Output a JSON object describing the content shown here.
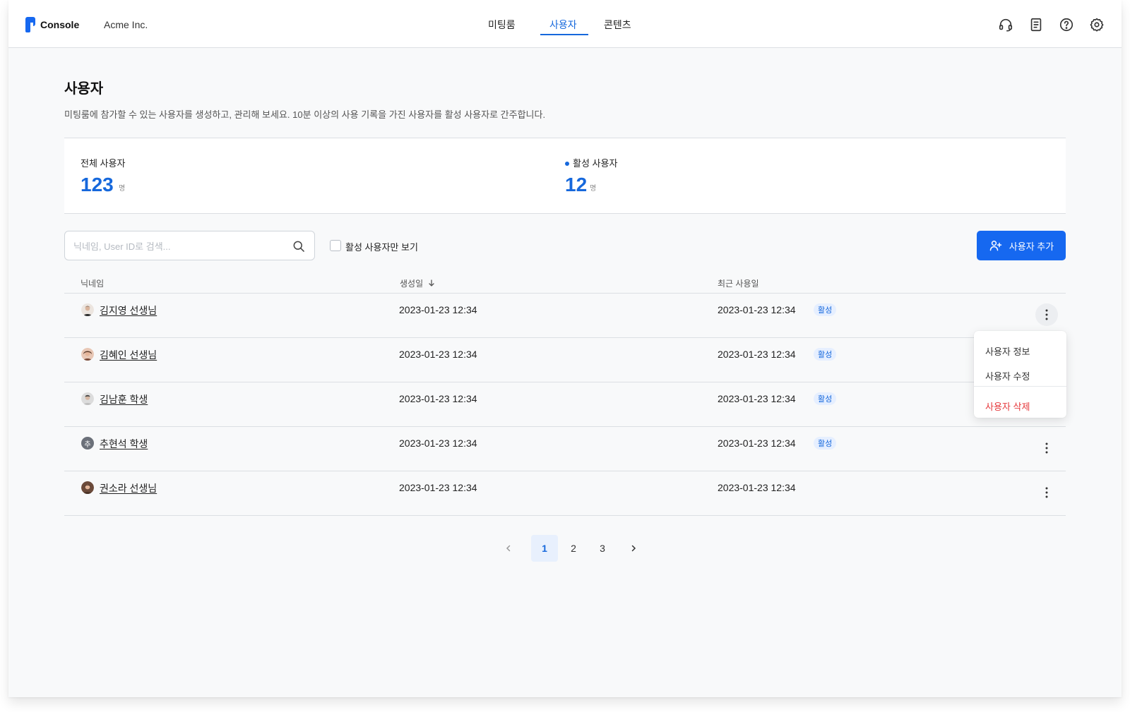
{
  "header": {
    "brand": "Console",
    "org": "Acme Inc.",
    "nav": [
      {
        "label": "미팅룸",
        "active": false
      },
      {
        "label": "사용자",
        "active": true
      },
      {
        "label": "콘텐츠",
        "active": false
      }
    ],
    "icons": [
      "headset-icon",
      "document-icon",
      "help-icon",
      "settings-icon"
    ],
    "accent_color": "#1668dc"
  },
  "page": {
    "title": "사용자",
    "description": "미팅룸에 참가할 수 있는 사용자를 생성하고, 관리해 보세요. 10분 이상의 사용 기록을 가진 사용자를 활성 사용자로 간주합니다."
  },
  "stats": {
    "total": {
      "label": "전체 사용자",
      "value": "123",
      "unit": "명"
    },
    "active": {
      "label": "활성 사용자",
      "value": "12",
      "unit": "명"
    }
  },
  "toolbar": {
    "search_placeholder": "닉네임, User ID로 검색...",
    "search_value": "",
    "filter_label": "활성 사용자만 보기",
    "filter_checked": false,
    "add_button_label": "사용자 추가"
  },
  "table": {
    "columns": [
      "닉네임",
      "생성일",
      "최근 사용일"
    ],
    "sort_column": "생성일",
    "sort_direction": "desc",
    "rows": [
      {
        "name": "김지영 선생님",
        "created": "2023-01-23 12:34",
        "recent": "2023-01-23 12:34",
        "badge": "활성",
        "avatar": "photo"
      },
      {
        "name": "김혜인 선생님",
        "created": "2023-01-23 12:34",
        "recent": "2023-01-23 12:34",
        "badge": "활성",
        "avatar": "photo"
      },
      {
        "name": "김남훈 학생",
        "created": "2023-01-23 12:34",
        "recent": "2023-01-23 12:34",
        "badge": "활성",
        "avatar": "photo"
      },
      {
        "name": "추현석 학생",
        "created": "2023-01-23 12:34",
        "recent": "2023-01-23 12:34",
        "badge": "활성",
        "avatar": "initial",
        "initial": "추"
      },
      {
        "name": "권소라 선생님",
        "created": "2023-01-23 12:34",
        "recent": "2023-01-23 12:34",
        "badge": "",
        "avatar": "photo"
      }
    ]
  },
  "menu": {
    "items": [
      {
        "label": "사용자 정보"
      },
      {
        "label": "사용자 수정"
      },
      {
        "label": "사용자 삭제",
        "danger": true
      }
    ]
  },
  "pagination": {
    "pages": [
      "1",
      "2",
      "3"
    ],
    "current": "1"
  }
}
